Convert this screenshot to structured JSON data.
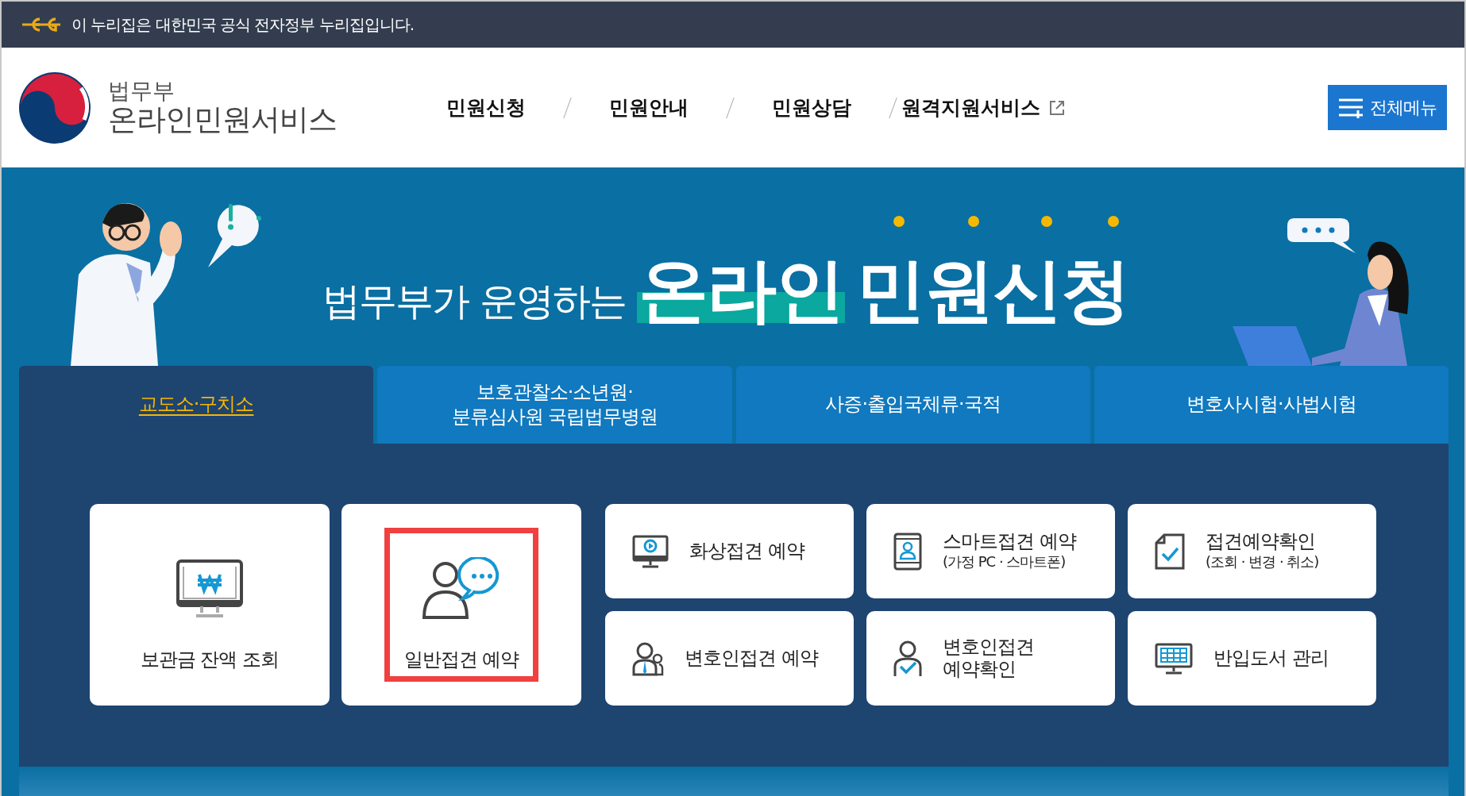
{
  "notice_bar": {
    "text": "이 누리집은 대한민국 공식 전자정부 누리집입니다."
  },
  "header": {
    "logo": {
      "ministry": "법무부",
      "service": "온라인민원서비스"
    },
    "nav": [
      {
        "label": "민원신청",
        "external": false
      },
      {
        "label": "민원안내",
        "external": false
      },
      {
        "label": "민원상담",
        "external": false
      },
      {
        "label": "원격지원서비스",
        "external": true
      }
    ],
    "menu_button": "전체메뉴"
  },
  "hero": {
    "headline": {
      "lead": "법무부가 운영하는",
      "highlight": "온라인",
      "rest": "민원신청"
    }
  },
  "tabs": [
    {
      "label": "교도소·구치소",
      "selected": true
    },
    {
      "label": "보호관찰소·소년원·\n분류심사원 국립법무병원",
      "selected": false
    },
    {
      "label": "사증·출입국체류·국적",
      "selected": false
    },
    {
      "label": "변호사시험·사법시험",
      "selected": false
    }
  ],
  "cards": [
    {
      "kind": "large",
      "title": "보관금 잔액 조회",
      "highlighted": false
    },
    {
      "kind": "large",
      "title": "일반접견 예약",
      "highlighted": true
    },
    {
      "kind": "small",
      "title": "화상접견 예약",
      "highlighted": false
    },
    {
      "kind": "small",
      "title": "스마트접견 예약",
      "subtitle": "(가정 PC · 스마트폰)",
      "highlighted": false
    },
    {
      "kind": "small",
      "title": "접견예약확인",
      "subtitle": "(조회 · 변경 · 취소)",
      "highlighted": false
    },
    {
      "kind": "small",
      "title": "변호인접견 예약",
      "highlighted": false
    },
    {
      "kind": "small",
      "title": "변호인접견\n예약확인",
      "highlighted": false
    },
    {
      "kind": "small",
      "title": "반입도서 관리",
      "highlighted": false
    }
  ]
}
